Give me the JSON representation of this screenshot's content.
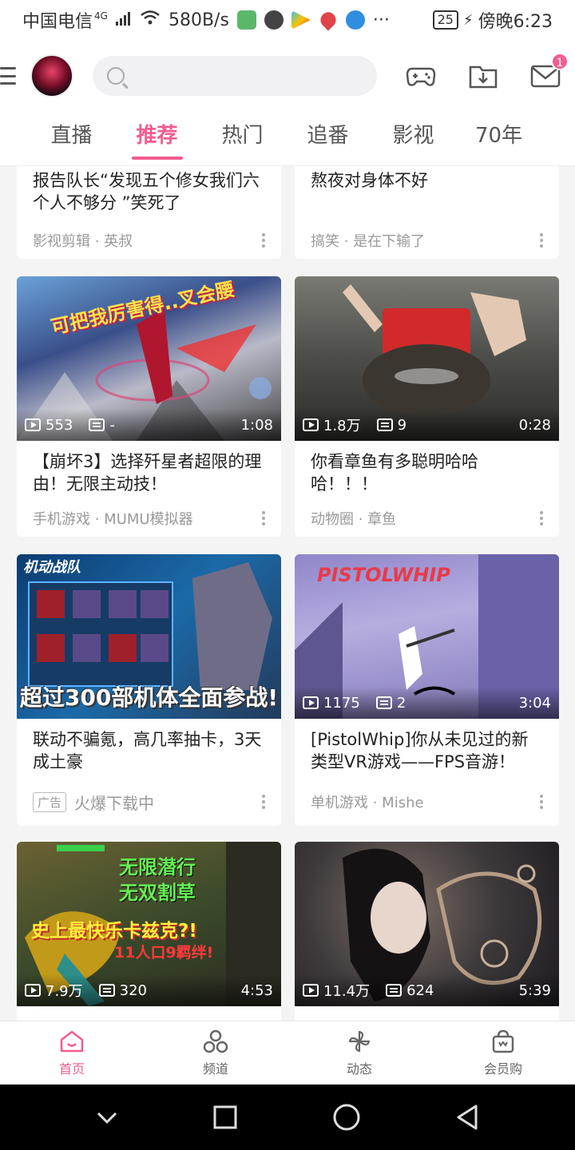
{
  "statusbar": {
    "carrier": "中国电信",
    "network": "4G",
    "speed": "580B/s",
    "battery": "25",
    "time": "傍晚6:23"
  },
  "header": {
    "search_placeholder": "",
    "mail_badge": "1"
  },
  "tabs": [
    {
      "label": "直播"
    },
    {
      "label": "推荐"
    },
    {
      "label": "热门"
    },
    {
      "label": "追番"
    },
    {
      "label": "影视"
    },
    {
      "label": "70年"
    }
  ],
  "cards": [
    {
      "title": "报告队长“发现五个修女我们六个人不够分 ”笑死了",
      "meta": "影视剪辑 · 英叔"
    },
    {
      "title": "熬夜对身体不好",
      "meta": "搞笑 · 是在下输了"
    },
    {
      "views": "553",
      "danmaku": "-",
      "duration": "1:08",
      "title": "【崩坏3】选择歼星者超限的理由！无限主动技！",
      "meta": "手机游戏 · MUMU模拟器"
    },
    {
      "views": "1.8万",
      "danmaku": "9",
      "duration": "0:28",
      "title": "你看章鱼有多聪明哈哈哈！！！",
      "meta": "动物圈 · 章鱼"
    },
    {
      "title": "联动不骗氪，高几率抽卡，3天成土豪",
      "ad_label": "广告",
      "meta": "火爆下载中",
      "thumb_text": "超过300部机体全面参战!"
    },
    {
      "views": "1175",
      "danmaku": "2",
      "duration": "3:04",
      "title": "[PistolWhip]你从未见过的新类型VR游戏——FPS音游！",
      "meta": "单机游戏 · Mishe",
      "thumb_text": "PISTOLWHIP"
    },
    {
      "views": "7.9万",
      "danmaku": "320",
      "duration": "4:53",
      "thumb_text_1": "无限潜行",
      "thumb_text_2": "无双割草",
      "thumb_text_3": "史上最快乐卡兹克?!",
      "thumb_text_4": "11人口9羁绊!"
    },
    {
      "views": "11.4万",
      "danmaku": "624",
      "duration": "5:39"
    }
  ],
  "bottomnav": [
    {
      "label": "首页"
    },
    {
      "label": "频道"
    },
    {
      "label": "动态"
    },
    {
      "label": "会员购"
    }
  ],
  "colors": {
    "accent": "#f25d8e"
  }
}
